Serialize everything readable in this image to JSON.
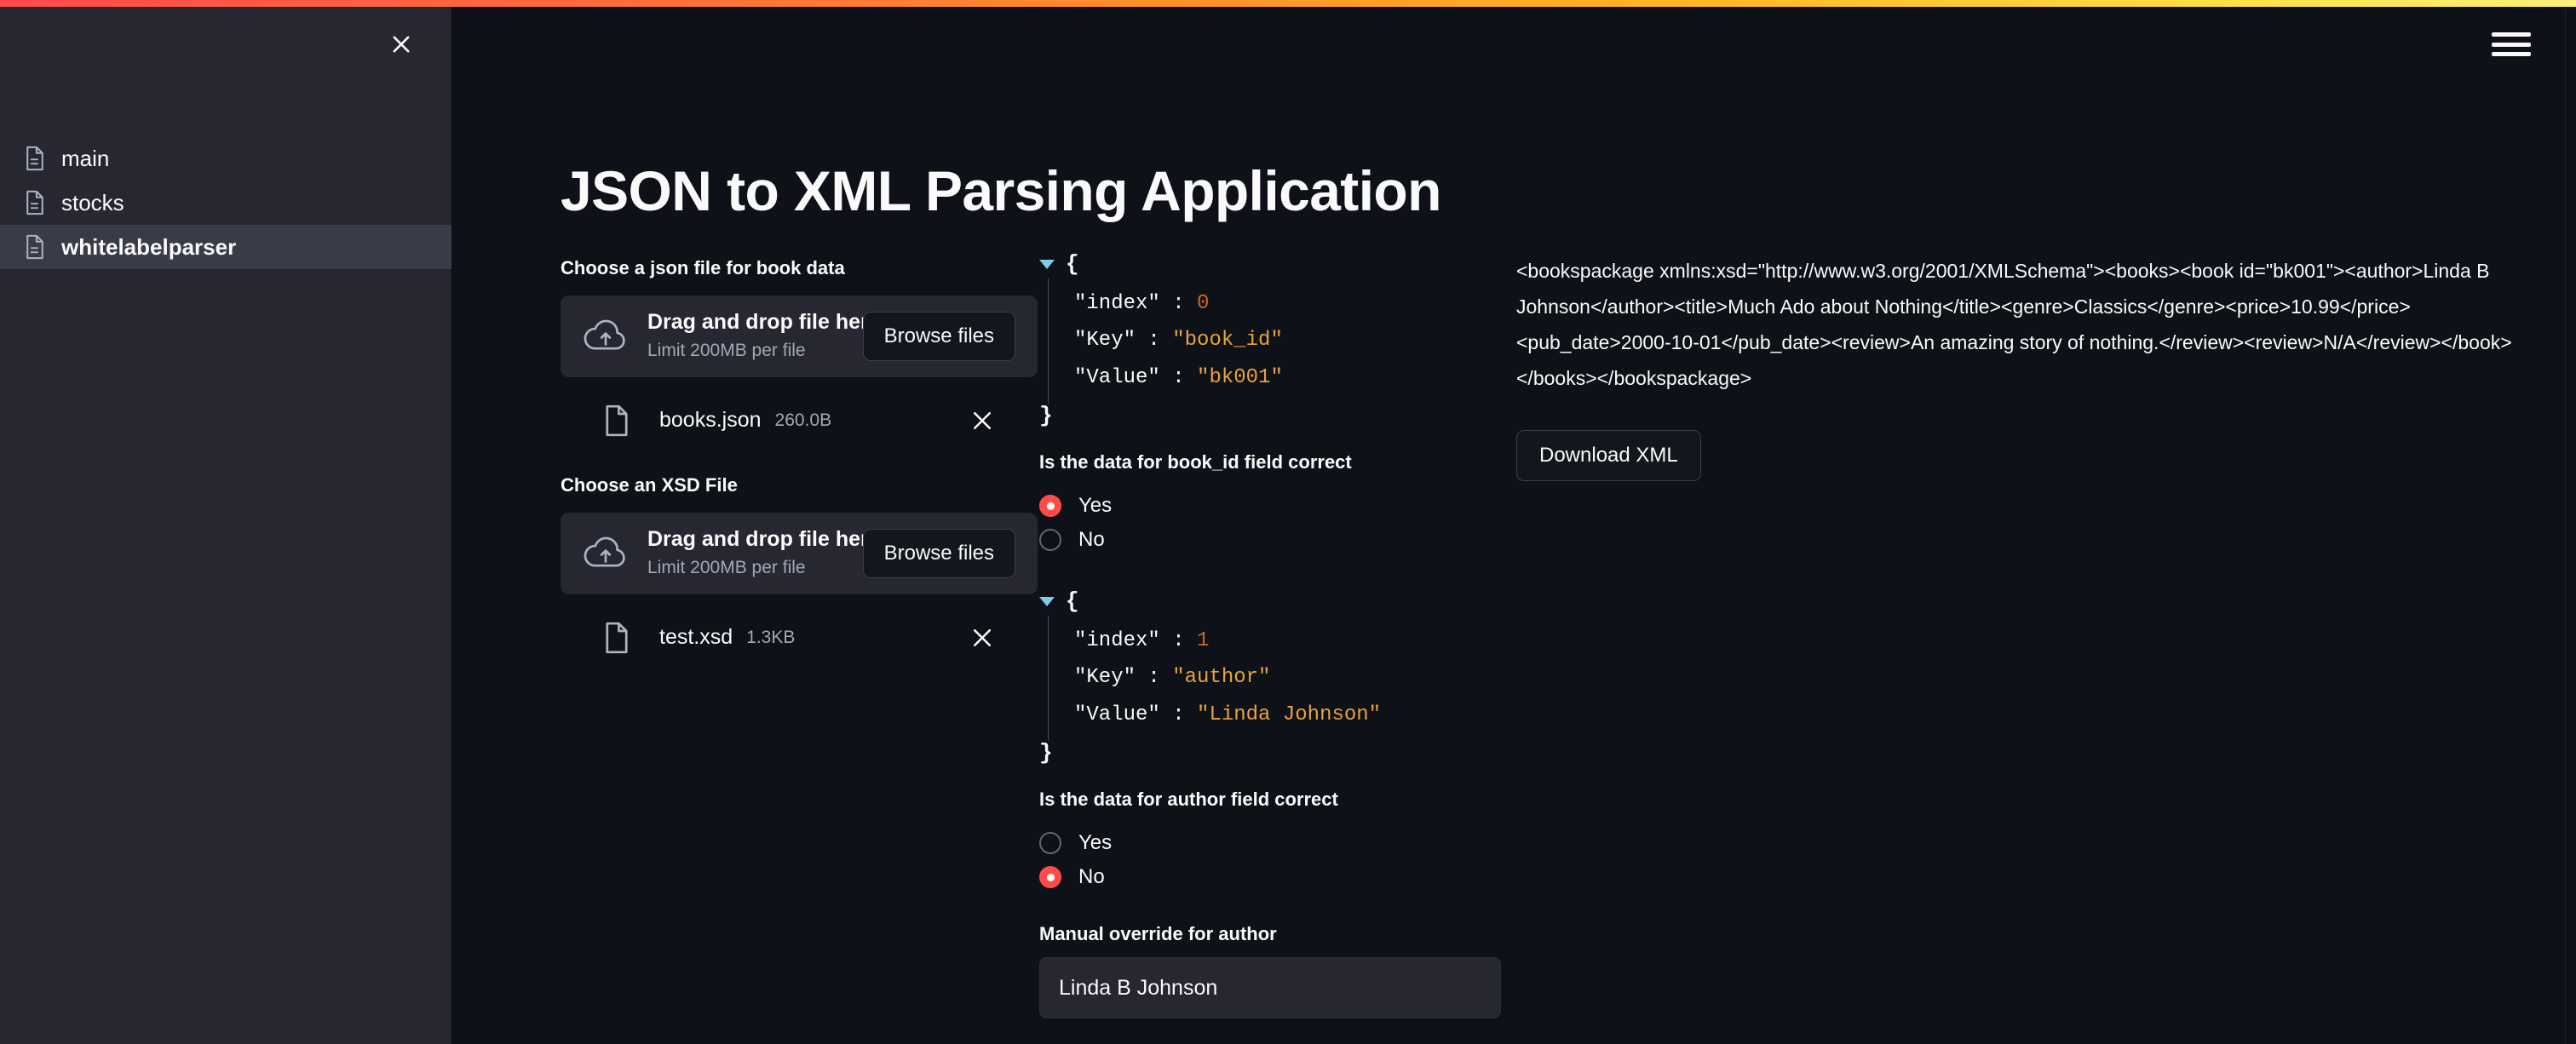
{
  "window": {
    "hamburger_icon": "hamburger-menu-icon",
    "accent_gradient_start": "#ff4b4b",
    "accent_gradient_end": "#fff07a"
  },
  "sidebar": {
    "close_icon": "close-x-icon",
    "items": [
      {
        "label": "main",
        "icon": "page-file-icon",
        "active": false
      },
      {
        "label": "stocks",
        "icon": "page-file-icon",
        "active": false
      },
      {
        "label": "whitelabelparser",
        "icon": "page-file-icon",
        "active": true
      }
    ]
  },
  "main": {
    "title": "JSON to XML Parsing Application",
    "uploaders": [
      {
        "label": "Choose a json file for book data",
        "drop_text": "Drag and drop file here",
        "limit_text": "Limit 200MB per file",
        "browse_label": "Browse files",
        "cloud_icon": "cloud-upload-icon",
        "file": {
          "name": "books.json",
          "size": "260.0B",
          "icon": "file-icon",
          "remove_icon": "close-x-icon"
        }
      },
      {
        "label": "Choose an XSD File",
        "drop_text": "Drag and drop file here",
        "limit_text": "Limit 200MB per file",
        "browse_label": "Browse files",
        "cloud_icon": "cloud-upload-icon",
        "file": {
          "name": "test.xsd",
          "size": "1.3KB",
          "icon": "file-icon",
          "remove_icon": "close-x-icon"
        }
      }
    ],
    "fields": [
      {
        "json": {
          "open_brace": "{",
          "close_brace": "}",
          "index_key": "\"index\"",
          "index_value": "0",
          "key_key": "\"Key\"",
          "key_value": "\"book_id\"",
          "value_key": "\"Value\"",
          "value_value": "\"bk001\"",
          "colon": ":"
        },
        "question": "Is the data for book_id field correct",
        "options": [
          "Yes",
          "No"
        ],
        "selected": "Yes",
        "override_label": null,
        "override_value": null
      },
      {
        "json": {
          "open_brace": "{",
          "close_brace": "}",
          "index_key": "\"index\"",
          "index_value": "1",
          "key_key": "\"Key\"",
          "key_value": "\"author\"",
          "value_key": "\"Value\"",
          "value_value": "\"Linda Johnson\"",
          "colon": ":"
        },
        "question": "Is the data for author field correct",
        "options": [
          "Yes",
          "No"
        ],
        "selected": "No",
        "override_label": "Manual override for author",
        "override_value": "Linda B Johnson"
      }
    ],
    "output": {
      "xml": "<bookspackage xmlns:xsd=\"http://www.w3.org/2001/XMLSchema\"><books><book id=\"bk001\"><author>Linda B Johnson</author><title>Much Ado about Nothing</title><genre>Classics</genre><price>10.99</price><pub_date>2000-10-01</pub_date><review>An amazing story of nothing.</review><review>N/A</review></book></books></bookspackage>",
      "download_label": "Download XML"
    }
  },
  "colors": {
    "accent_red": "#ff4b4b",
    "background": "#0e1117",
    "sidebar_bg": "#262730",
    "sidebar_active": "#393b47",
    "json_string": "#e8a33d",
    "json_number": "#d4641c",
    "tree_toggle": "#83c9e8"
  }
}
